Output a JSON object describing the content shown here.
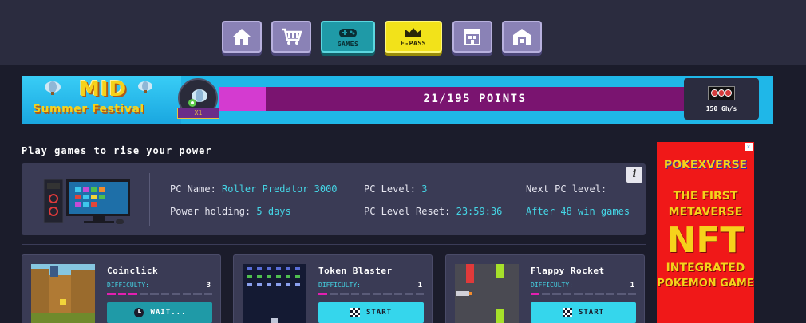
{
  "nav": {
    "items": [
      {
        "name": "home",
        "label": ""
      },
      {
        "name": "shop",
        "label": ""
      },
      {
        "name": "games",
        "label": "GAMES"
      },
      {
        "name": "epass",
        "label": "E-PASS"
      },
      {
        "name": "store",
        "label": ""
      },
      {
        "name": "house",
        "label": ""
      }
    ]
  },
  "banner": {
    "title_top": "MID",
    "title_bottom": "Summer Festival",
    "multiplier": "X1",
    "points_text": "21/195 POINTS",
    "points_current": 21,
    "points_total": 195,
    "power": "150 Gh/s"
  },
  "section_title": "Play games to rise your power",
  "pc": {
    "name_label": "PC Name:",
    "name_value": "Roller Predator 3000",
    "holding_label": "Power holding:",
    "holding_value": "5 days",
    "level_label": "PC Level:",
    "level_value": "3",
    "reset_label": "PC Level Reset:",
    "reset_value": "23:59:36",
    "next_label": "Next PC level:",
    "next_value": "After 48 win games",
    "info_label": "i"
  },
  "games": [
    {
      "title": "Coinclick",
      "difficulty_label": "DIFFICULTY:",
      "difficulty": 3,
      "button": "WAIT...",
      "state": "wait"
    },
    {
      "title": "Token Blaster",
      "difficulty_label": "DIFFICULTY:",
      "difficulty": 1,
      "button": "START",
      "state": "start"
    },
    {
      "title": "Flappy Rocket",
      "difficulty_label": "DIFFICULTY:",
      "difficulty": 1,
      "button": "START",
      "state": "start"
    }
  ],
  "ad": {
    "brand": "POKEXVERSE",
    "line1": "THE FIRST",
    "line2": "METAVERSE",
    "line3": "NFT",
    "line4": "INTEGRATED",
    "line5": "POKEMON GAME"
  },
  "colors": {
    "accent": "#35d6ec",
    "games_btn": "#1f9aa7",
    "epass_btn": "#f2e21a",
    "nav_btn": "#8a82b6",
    "bar_on": "#e21fb1"
  }
}
